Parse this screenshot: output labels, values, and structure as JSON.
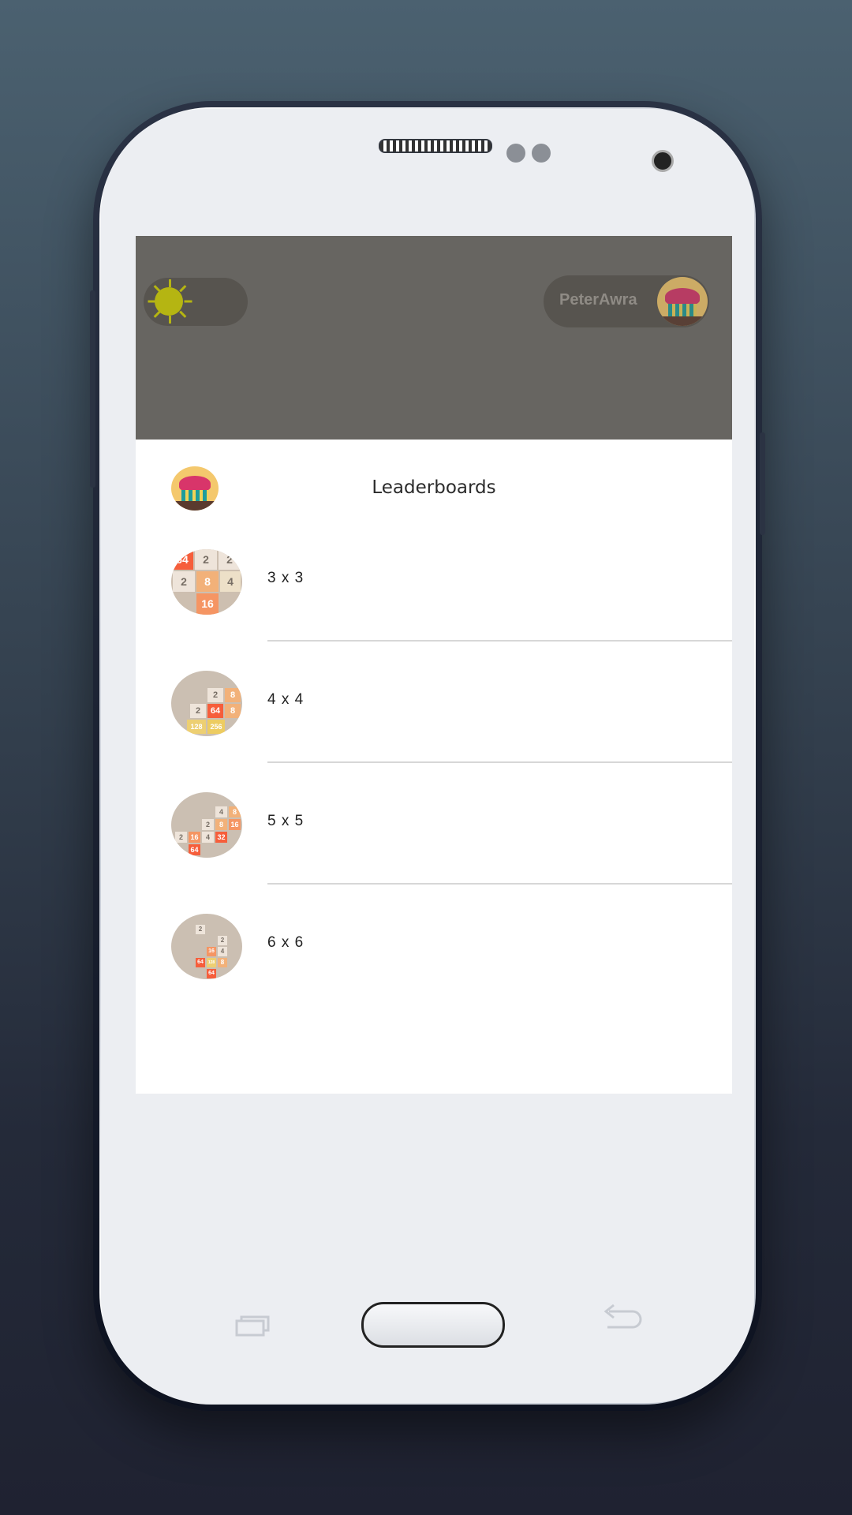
{
  "header": {
    "user_name": "PeterAwra",
    "theme_icon": "sun-icon",
    "avatar_icon": "cupcake-avatar-icon"
  },
  "sheet": {
    "title": "Leaderboards",
    "items": [
      {
        "label": "3 x 3",
        "icon": "board-3x3-thumbnail"
      },
      {
        "label": "4 x 4",
        "icon": "board-4x4-thumbnail"
      },
      {
        "label": "5 x 5",
        "icon": "board-5x5-thumbnail"
      },
      {
        "label": "6 x 6",
        "icon": "board-6x6-thumbnail"
      }
    ]
  },
  "thumbs": {
    "t3": [
      "64",
      "2",
      "2",
      "2",
      "8",
      "4",
      "16"
    ],
    "t4": [
      "2",
      "8",
      "2",
      "64",
      "8",
      "128",
      "256"
    ],
    "t5": [
      "4",
      "8",
      "2",
      "8",
      "16",
      "2",
      "16",
      "4",
      "32",
      "64"
    ],
    "t6": [
      "2",
      "2",
      "16",
      "4",
      "64",
      "128",
      "8",
      "64"
    ]
  },
  "colors": {
    "overlay": "#676561",
    "tile_light": "#eee4da",
    "tile_orange": "#f2b179",
    "tile_red": "#f65e3b",
    "tile_yellow": "#edcf72"
  }
}
